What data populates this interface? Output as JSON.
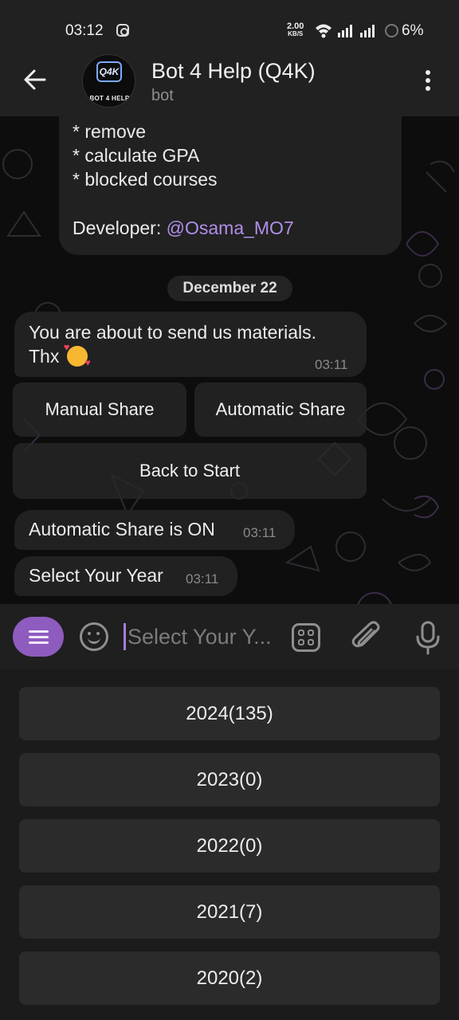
{
  "status_bar": {
    "time": "03:12",
    "net_speed_value": "2.00",
    "net_speed_unit": "KB/S",
    "battery": "6%"
  },
  "header": {
    "title": "Bot 4 Help (Q4K)",
    "subtitle": "bot",
    "avatar_logo": "Q4K",
    "avatar_caption": "BOT 4 HELP"
  },
  "chat": {
    "first_message_lines": [
      "* remove",
      "* calculate GPA",
      "* blocked courses"
    ],
    "developer_label": "Developer: ",
    "developer_handle": "@Osama_MO7",
    "date_separator": "December 22",
    "materials_message_line1": "You are about to send us materials.",
    "materials_message_line2": "Thx",
    "materials_message_time": "03:11",
    "inline_buttons": {
      "manual_share": "Manual Share",
      "automatic_share": "Automatic Share",
      "back_to_start": "Back to Start"
    },
    "auto_share_message": "Automatic Share is ON",
    "auto_share_time": "03:11",
    "select_year_message": "Select Your Year",
    "select_year_time": "03:11"
  },
  "input_bar": {
    "placeholder": "Select Your Y..."
  },
  "reply_keyboard": {
    "years": [
      "2024(135)",
      "2023(0)",
      "2022(0)",
      "2021(7)",
      "2020(2)"
    ]
  },
  "colors": {
    "accent": "#8e5bbf",
    "link": "#b08ee8",
    "bubble": "#212121",
    "chat_bg": "#0d0d0d"
  },
  "icons": [
    "instagram-icon",
    "wifi-icon",
    "signal-icon",
    "back-arrow-icon",
    "more-vert-icon",
    "menu-icon",
    "emoji-icon",
    "bot-commands-icon",
    "attach-icon",
    "mic-icon"
  ]
}
